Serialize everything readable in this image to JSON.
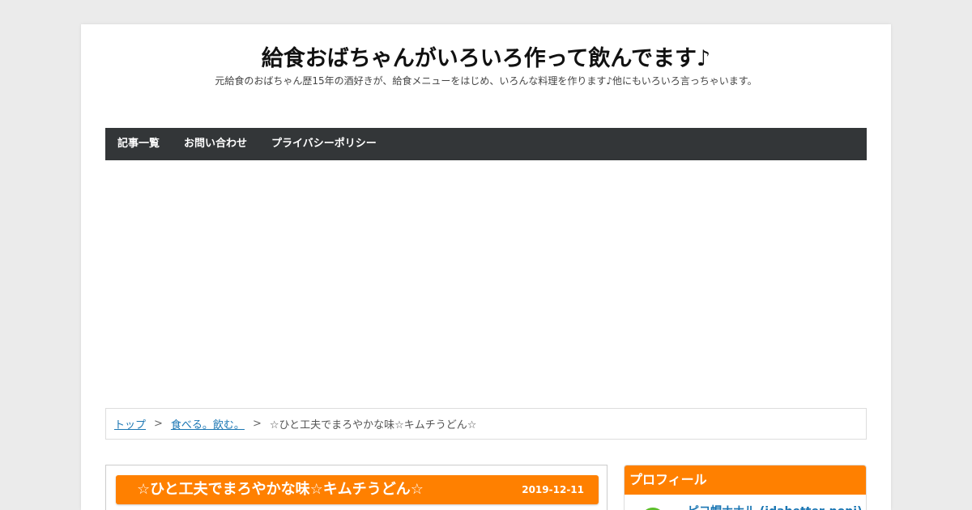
{
  "site": {
    "title": "給食おばちゃんがいろいろ作って飲んでます♪",
    "description": "元給食のおばちゃん歴15年の酒好きが、給食メニューをはじめ、いろんな料理を作ります♪他にもいろいろ言っちゃいます。"
  },
  "nav": {
    "items": [
      {
        "label": "記事一覧"
      },
      {
        "label": "お問い合わせ"
      },
      {
        "label": "プライバシーポリシー"
      }
    ]
  },
  "breadcrumb": {
    "home": "トップ",
    "category": "食べる。飲む。",
    "current": "☆ひと工夫でまろやかな味☆キムチうどん☆",
    "separator": ">"
  },
  "article": {
    "title": "☆ひと工夫でまろやかな味☆キムチうどん☆",
    "date": "2019-12-11"
  },
  "sidebar": {
    "profile_title": "プロフィール",
    "profile_name": "ピコ帽ナナル (idabetter-nopi)"
  },
  "colors": {
    "accent": "#ff8000",
    "nav_bg": "#333638",
    "link": "#1a76b3",
    "page_bg": "#ebebeb"
  }
}
